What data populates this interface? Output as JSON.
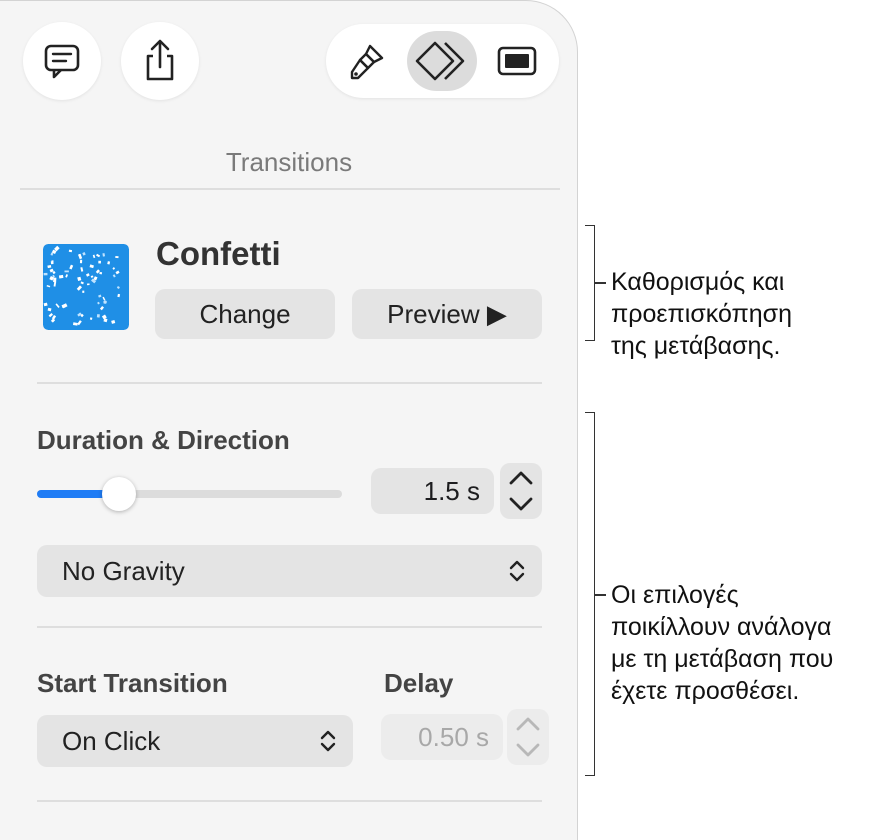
{
  "toolbar": {
    "comment_icon": "comment-bubble-icon",
    "share_icon": "share-icon",
    "format_icon": "paintbrush-icon",
    "animate_icon": "animate-diamond-icon",
    "document_icon": "document-icon"
  },
  "inspector": {
    "title": "Transitions",
    "transition": {
      "name": "Confetti",
      "change_label": "Change",
      "preview_label": "Preview ▶",
      "thumbnail_color": "#1f8fe6"
    },
    "duration": {
      "section_label": "Duration & Direction",
      "slider_fraction": 0.27,
      "value": "1.5 s"
    },
    "direction": {
      "selected": "No Gravity"
    },
    "start": {
      "label": "Start Transition",
      "selected": "On Click"
    },
    "delay": {
      "label": "Delay",
      "value": "0.50 s"
    }
  },
  "callouts": {
    "top": [
      "Καθορισμός και",
      "προεπισκόπηση",
      "της μετάβασης."
    ],
    "bottom": [
      "Οι επιλογές",
      "ποικίλλουν ανάλογα",
      "με τη μετάβαση που",
      "έχετε προσθέσει."
    ]
  },
  "colors": {
    "accent": "#1f7cf5",
    "panel_background": "#f5f5f5"
  }
}
